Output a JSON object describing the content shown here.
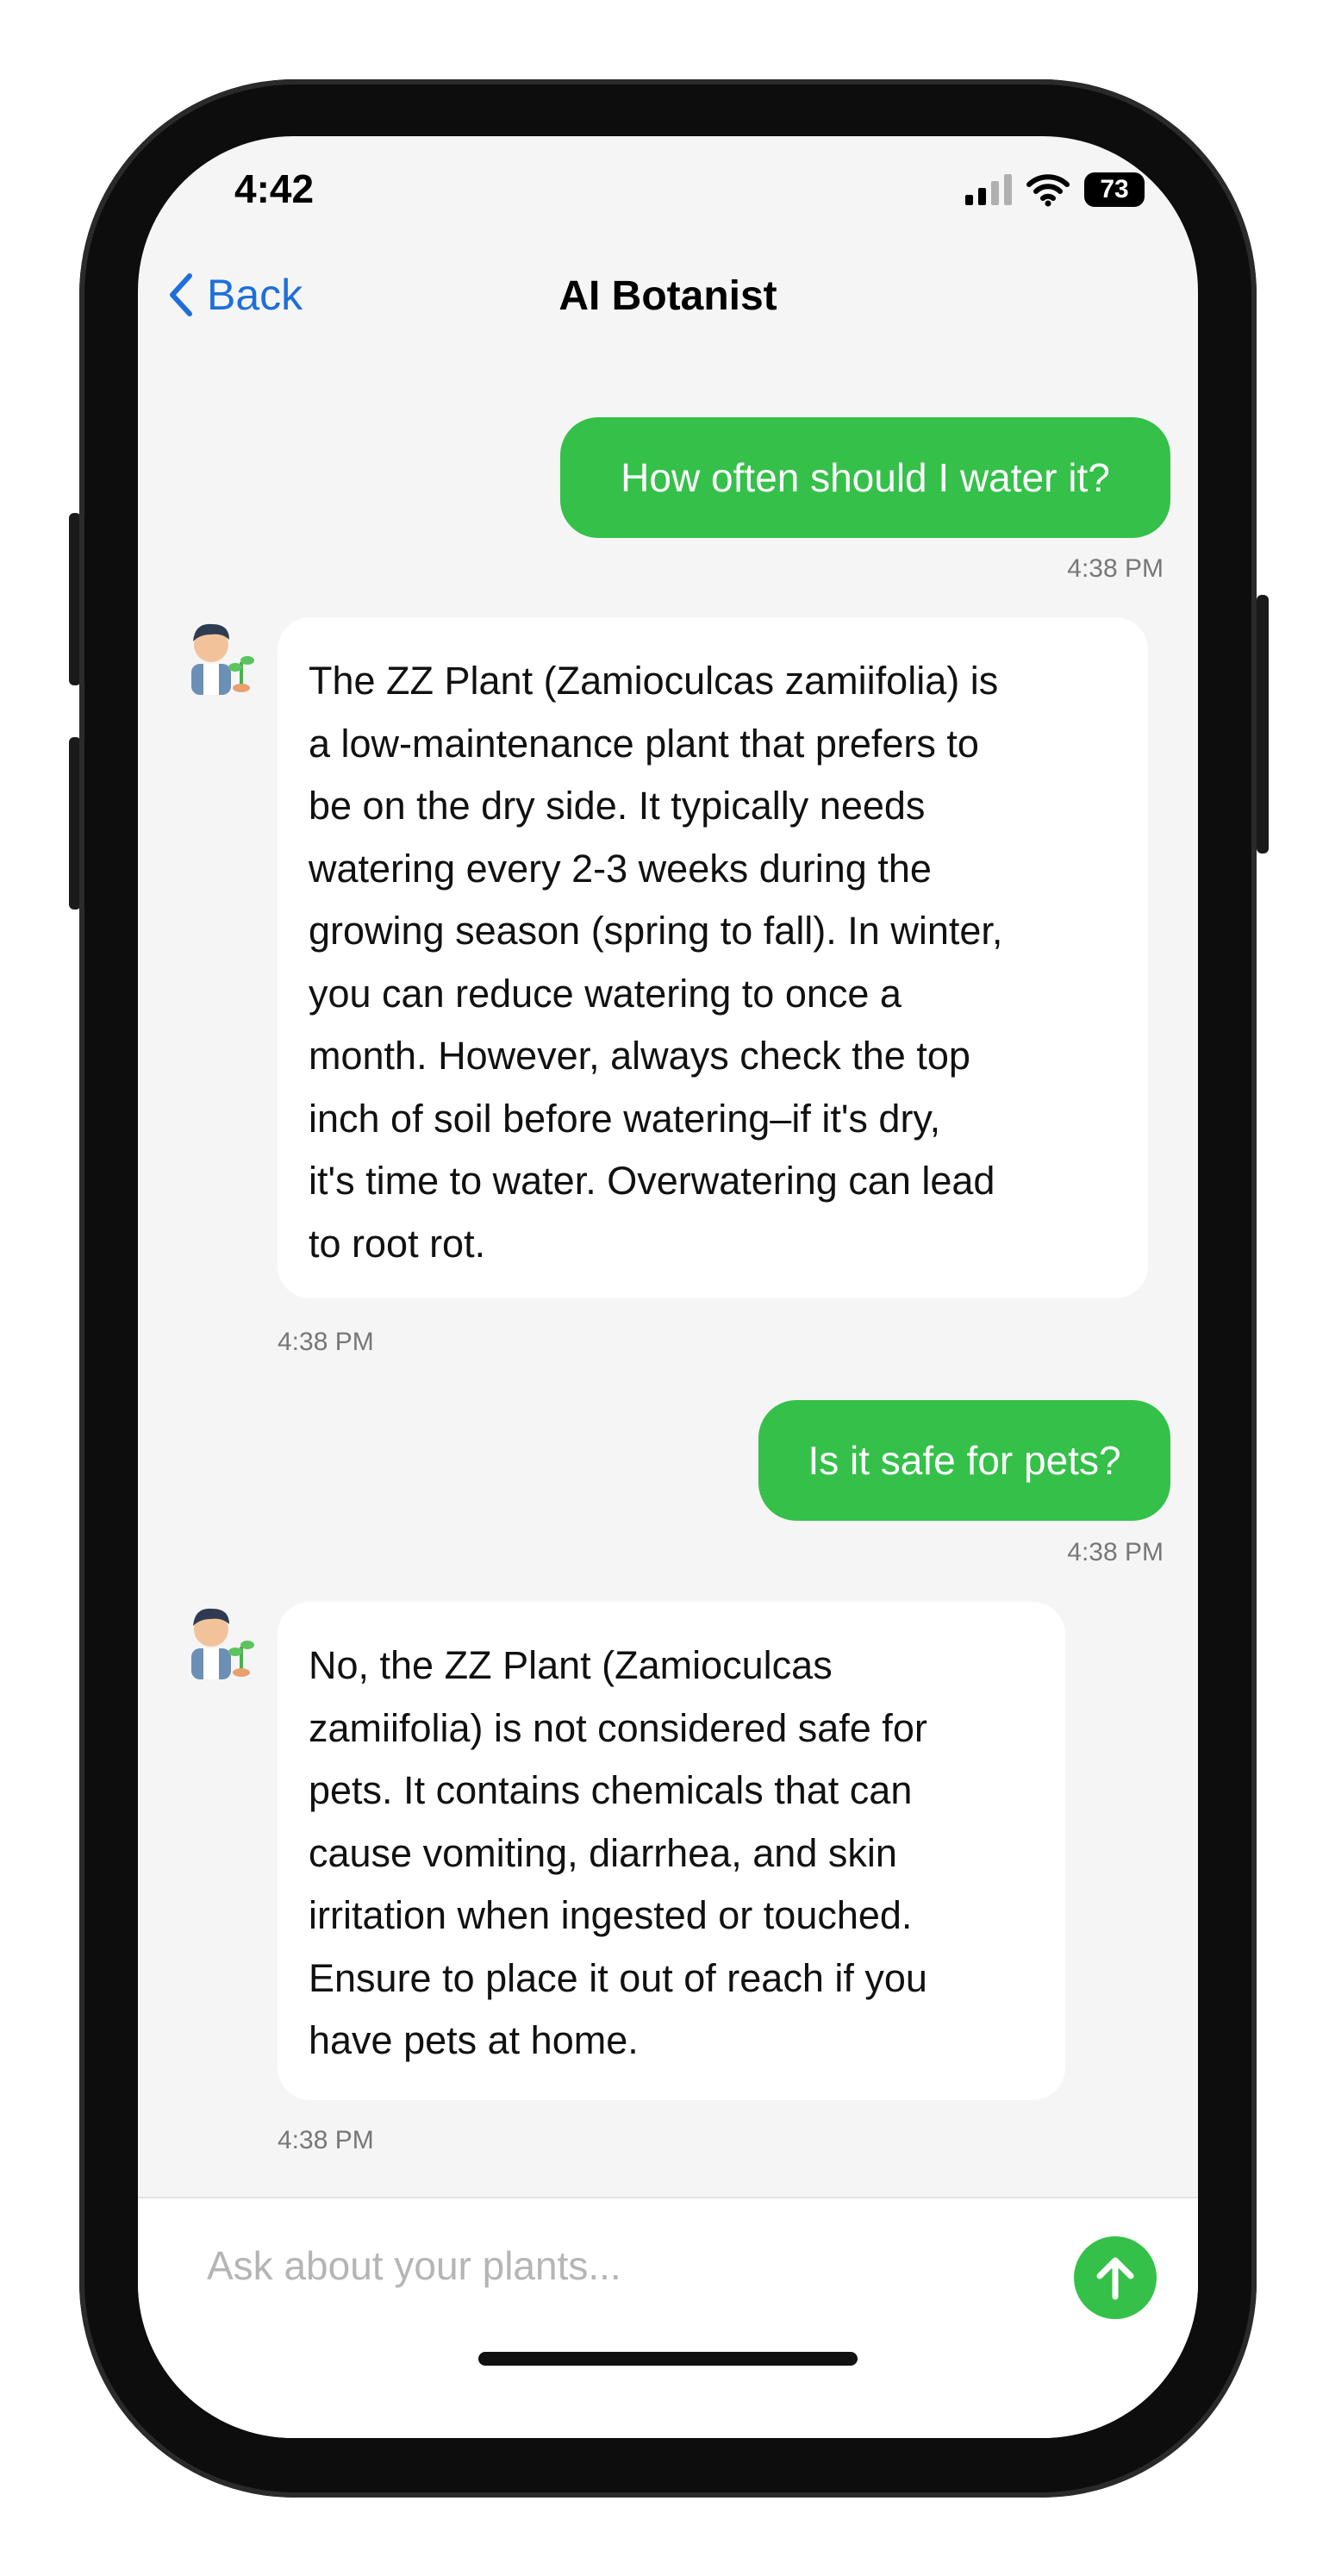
{
  "status_bar": {
    "time": "4:42",
    "battery": "73"
  },
  "nav": {
    "back_label": "Back",
    "title": "AI Botanist"
  },
  "messages": [
    {
      "role": "user",
      "text": "How often should I water it?",
      "time": "4:38 PM"
    },
    {
      "role": "assistant",
      "lines": [
        "The ZZ Plant (Zamioculcas zamiifolia) is",
        "a low-maintenance plant that prefers to",
        "be on the dry side. It typically needs",
        "watering every 2-3 weeks during the",
        "growing season (spring to fall). In winter,",
        "you can reduce watering to once a",
        "month. However, always check the top",
        "inch of soil before watering–if it's dry,",
        "it's time to water. Overwatering can lead",
        "to root rot."
      ],
      "time": "4:38 PM"
    },
    {
      "role": "user",
      "text": "Is it safe for pets?",
      "time": "4:38 PM"
    },
    {
      "role": "assistant",
      "lines": [
        "No, the ZZ Plant (Zamioculcas",
        "zamiifolia) is not considered safe for",
        "pets. It contains chemicals that can",
        "cause vomiting, diarrhea, and skin",
        "irritation when ingested or touched.",
        "Ensure to place it out of reach if you",
        "have pets at home."
      ],
      "time": "4:38 PM"
    }
  ],
  "input": {
    "placeholder": "Ask about your plants..."
  },
  "icons": {
    "back": "chevron-left-icon",
    "send": "arrow-up-icon",
    "avatar": "botanist-avatar-icon"
  },
  "colors": {
    "accent": "#35c04a",
    "link": "#1e6fd9",
    "background": "#f5f5f5"
  }
}
